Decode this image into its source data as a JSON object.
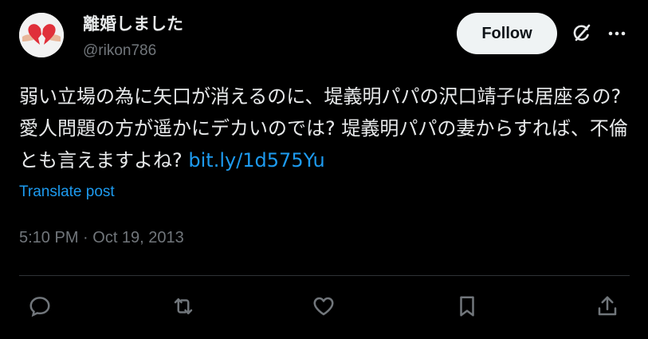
{
  "author": {
    "display_name": "離婚しました",
    "handle": "@rikon786",
    "avatar_icon": "broken-heart-icon"
  },
  "header": {
    "follow_label": "Follow",
    "grok_icon": "grok-icon",
    "more_icon": "more-icon"
  },
  "tweet": {
    "text": "弱い立場の為に矢口が消えるのに、堤義明パパの沢口靖子は居座るの? 愛人問題の方が遥かにデカいのでは? 堤義明パパの妻からすれば、不倫とも言えますよね? ",
    "link": "bit.ly/1d575Yu",
    "translate_label": "Translate post",
    "timestamp": "5:10 PM · Oct 19, 2013"
  },
  "actions": [
    {
      "name": "reply-icon"
    },
    {
      "name": "retweet-icon"
    },
    {
      "name": "like-icon"
    },
    {
      "name": "bookmark-icon"
    },
    {
      "name": "share-icon"
    }
  ],
  "colors": {
    "background": "#000000",
    "text": "#e7e9ea",
    "muted": "#71767b",
    "link": "#1d9bf0",
    "divider": "#2f3336",
    "follow_bg": "#eff3f4"
  }
}
